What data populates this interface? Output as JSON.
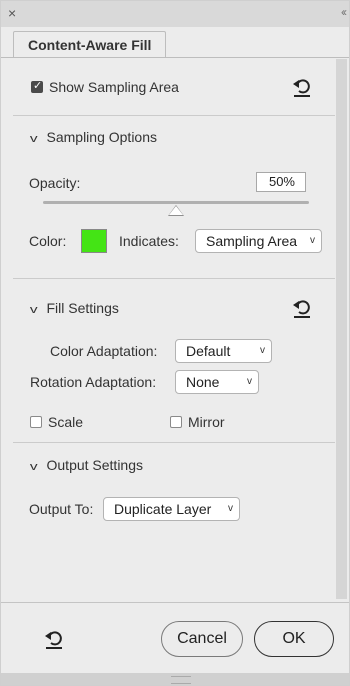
{
  "window": {
    "close_glyph": "×",
    "collapse_glyph": "‹‹"
  },
  "tab": {
    "label": "Content-Aware Fill"
  },
  "show_sampling": {
    "label": "Show Sampling Area",
    "checked": true
  },
  "sampling_options": {
    "header": "Sampling Options",
    "opacity_label": "Opacity:",
    "opacity_value": "50%",
    "opacity_fraction": 0.5,
    "color_label": "Color:",
    "color_hex": "#44e415",
    "indicates_label": "Indicates:",
    "indicates_value": "Sampling Area"
  },
  "fill_settings": {
    "header": "Fill Settings",
    "color_adaptation_label": "Color Adaptation:",
    "color_adaptation_value": "Default",
    "rotation_adaptation_label": "Rotation Adaptation:",
    "rotation_adaptation_value": "None",
    "scale_label": "Scale",
    "scale_checked": false,
    "mirror_label": "Mirror",
    "mirror_checked": false
  },
  "output_settings": {
    "header": "Output Settings",
    "output_to_label": "Output To:",
    "output_to_value": "Duplicate Layer"
  },
  "footer": {
    "cancel_label": "Cancel",
    "ok_label": "OK"
  },
  "icons": {
    "reset": "reset-icon",
    "chevron": "chevron-down-icon"
  }
}
